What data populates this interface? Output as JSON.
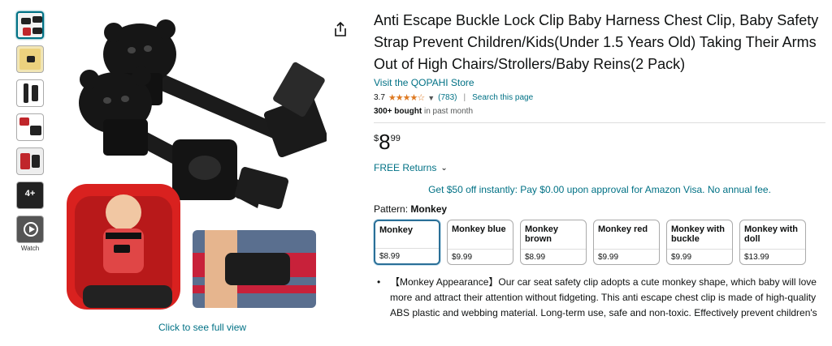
{
  "thumbnails": [
    {
      "name": "thumb-1",
      "selected": true
    },
    {
      "name": "thumb-2"
    },
    {
      "name": "thumb-3"
    },
    {
      "name": "thumb-4"
    },
    {
      "name": "thumb-5"
    },
    {
      "name": "thumb-6",
      "text": "4+"
    },
    {
      "name": "thumb-video",
      "label": "Watch"
    }
  ],
  "gallery": {
    "see_full_view": "Click to see full view"
  },
  "product": {
    "title": "Anti Escape Buckle Lock Clip Baby Harness Chest Clip, Baby Safety Strap Prevent Children/Kids(Under 1.5 Years Old) Taking Their Arms Out of High Chairs/Strollers/Baby Reins(2 Pack)",
    "store_link": "Visit the QOPAHI Store",
    "rating": "3.7",
    "stars": "★★★★☆",
    "review_count": "(783)",
    "search_page": "Search this page",
    "bought_bold": "300+ bought",
    "bought_rest": " in past month",
    "price_currency": "$",
    "price_whole": "8",
    "price_fraction": "99",
    "returns": "FREE Returns",
    "promo": "Get $50 off instantly: Pay $0.00 upon approval for Amazon Visa. No annual fee.",
    "pattern_label": "Pattern:",
    "pattern_value": "Monkey"
  },
  "options": [
    {
      "name": "Monkey",
      "price": "$8.99",
      "selected": true
    },
    {
      "name": "Monkey blue",
      "price": "$9.99"
    },
    {
      "name": "Monkey brown",
      "price": "$8.99"
    },
    {
      "name": "Monkey red",
      "price": "$9.99"
    },
    {
      "name": "Monkey with buckle",
      "price": "$9.99"
    },
    {
      "name": "Monkey with doll",
      "price": "$13.99"
    }
  ],
  "bullets": [
    "【Monkey Appearance】Our car seat safety clip adopts a cute monkey shape, which baby will love more and attract their attention without fidgeting. This anti escape chest clip is made of high-quality ABS plastic and webbing material. Long-term use, safe and non-toxic. Effectively prevent children's"
  ],
  "colors": {
    "link": "#007185",
    "star": "#de7921",
    "selected_border": "#2a6f97"
  }
}
